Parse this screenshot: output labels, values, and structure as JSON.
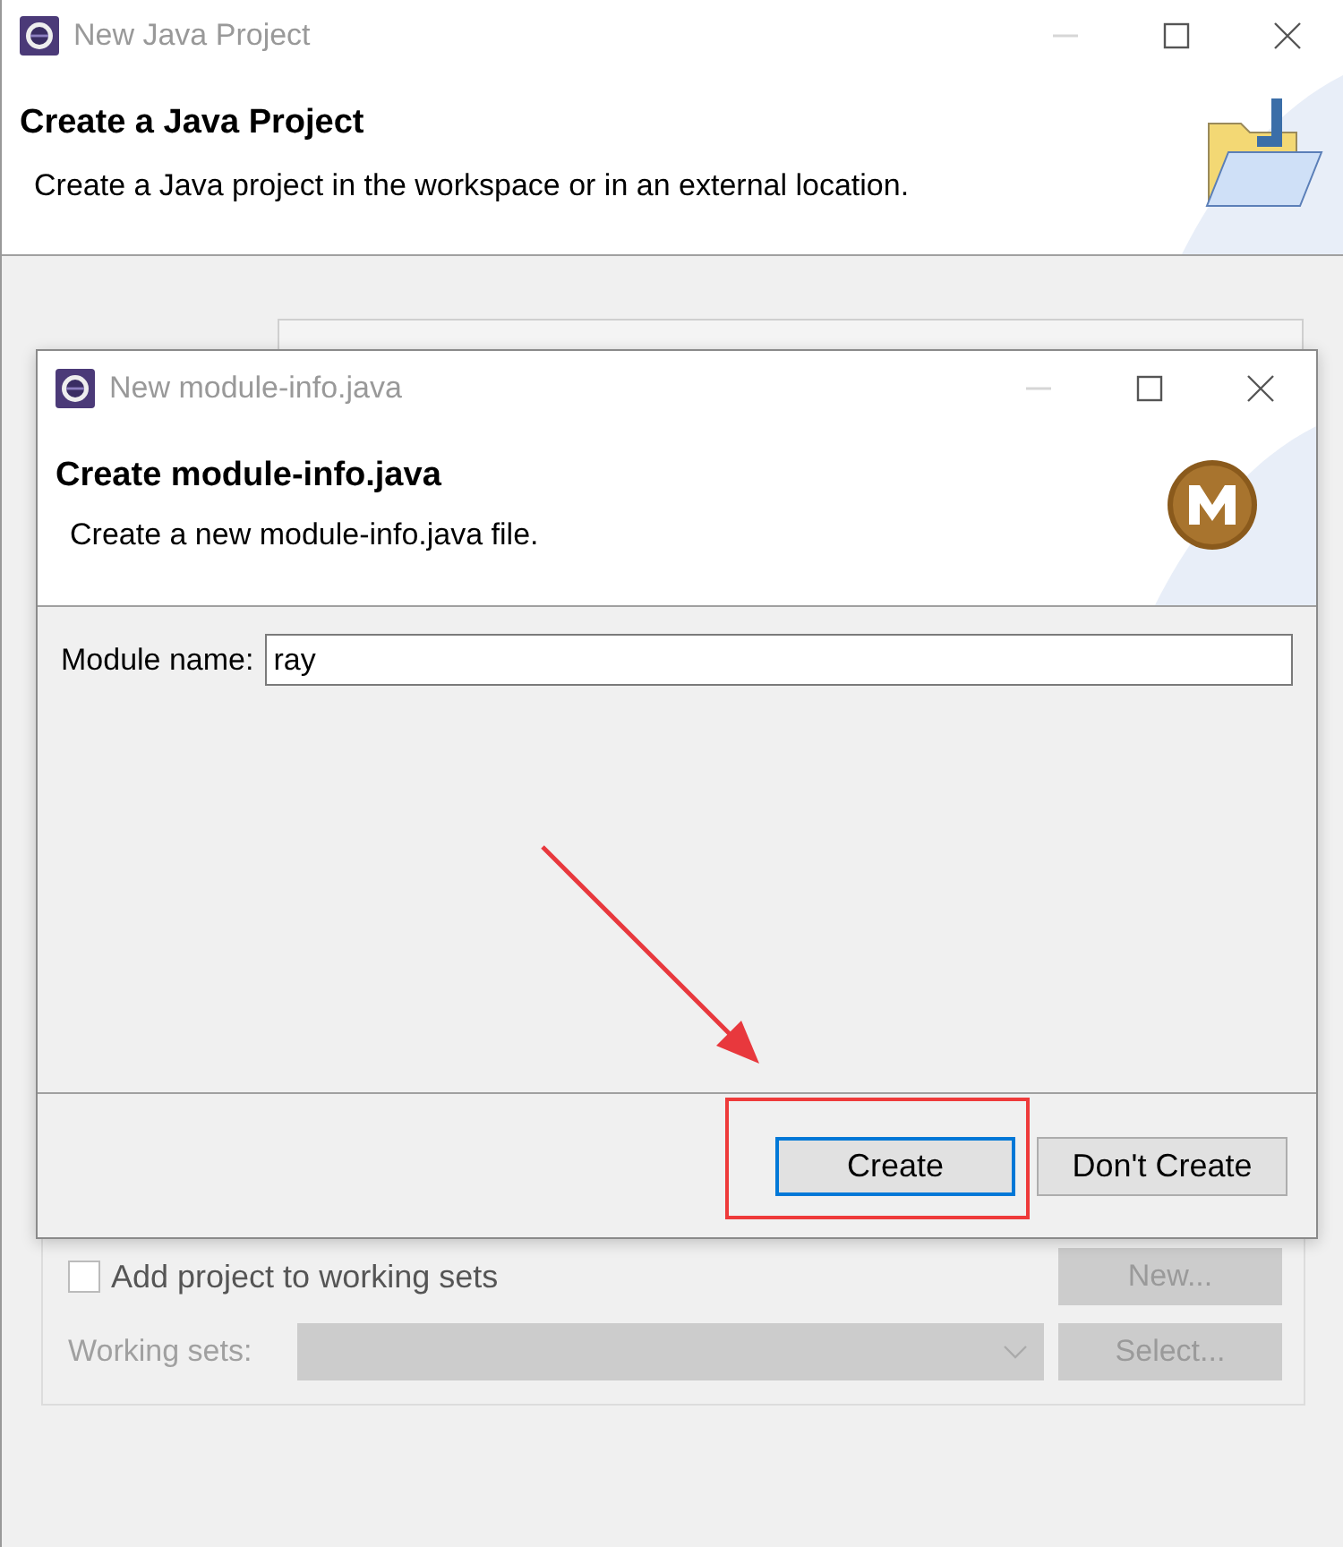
{
  "window": {
    "title": "New Java Project"
  },
  "header": {
    "title": "Create a Java Project",
    "description": "Create a Java project in the workspace or in an external location."
  },
  "working_sets_group": {
    "add_checkbox": {
      "label": "Add project to working sets",
      "checked": false
    },
    "new_button": {
      "label": "New...",
      "disabled": true
    },
    "working_sets": {
      "label": "Working sets:",
      "disabled": true
    },
    "select_button": {
      "label": "Select...",
      "disabled": true
    }
  },
  "dialog": {
    "title": "New module-info.java",
    "header": {
      "title": "Create module-info.java",
      "description": "Create a new module-info.java file."
    },
    "module_name": {
      "label": "Module name:",
      "value": "ray"
    },
    "buttons": [
      {
        "label": "Create",
        "default": true
      },
      {
        "label": "Don't Create",
        "default": false
      }
    ]
  }
}
